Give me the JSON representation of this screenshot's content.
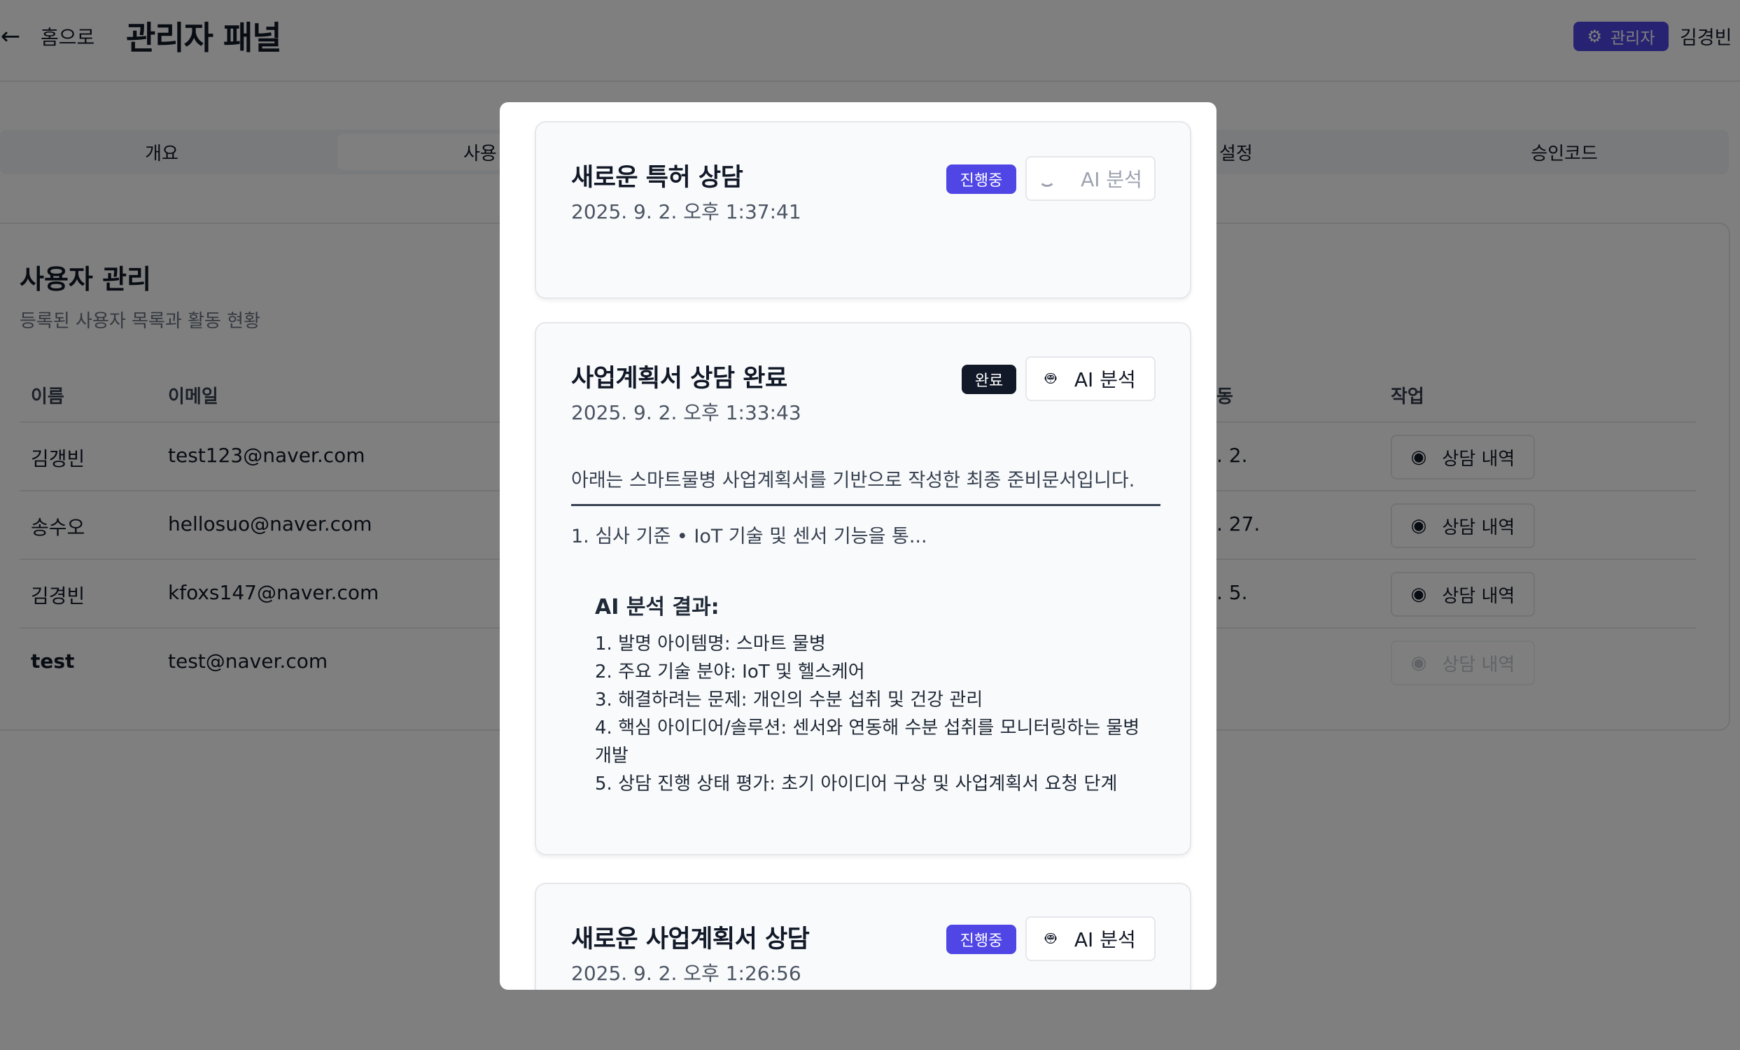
{
  "header": {
    "back_label": "홈으로",
    "title": "관리자 패널",
    "admin_badge": "관리자",
    "user_name": "김경빈"
  },
  "tabs": [
    "개요",
    "사용",
    "설정",
    "승인코드"
  ],
  "users_section": {
    "title": "사용자 관리",
    "subtitle": "등록된 사용자 목록과 활동 현황",
    "columns": [
      "이름",
      "이메일",
      "동",
      "작업"
    ],
    "rows": [
      {
        "name": "김갱빈",
        "email": "test123@naver.com",
        "date": ". 2.",
        "action": "상담 내역"
      },
      {
        "name": "송수오",
        "email": "hellosuo@naver.com",
        "date": ". 27.",
        "action": "상담 내역"
      },
      {
        "name": "김경빈",
        "email": "kfoxs147@naver.com",
        "date": ". 5.",
        "action": "상담 내역"
      },
      {
        "name": "test",
        "email": "test@naver.com",
        "date": "",
        "action": "상담 내역"
      }
    ]
  },
  "modal": {
    "consultations": [
      {
        "title": "새로운 특허 상담",
        "date": "2025. 9. 2. 오후 1:37:41",
        "status": "진행중",
        "ai_label": "AI 분석"
      },
      {
        "title": "사업계획서 상담 완료",
        "date": "2025. 9. 2. 오후 1:33:43",
        "status": "완료",
        "ai_label": "AI 분석",
        "summary": "아래는 스마트물병 사업계획서를 기반으로 작성한 최종 준비문서입니다.",
        "preview": "1. 심사 기준 • IoT 기술 및 센서 기능을 통...",
        "analysis_title": "AI 분석 결과:",
        "analysis_items": [
          "1. 발명 아이템명: 스마트 물병",
          "2. 주요 기술 분야: IoT 및 헬스케어",
          "3. 해결하려는 문제: 개인의 수분 섭취 및 건강 관리",
          "4. 핵심 아이디어/솔루션: 센서와 연동해 수분 섭취를 모니터링하는 물병 개발",
          "5. 상담 진행 상태 평가: 초기 아이디어 구상 및 사업계획서 요청 단계"
        ]
      },
      {
        "title": "새로운 사업계획서 상담",
        "date": "2025. 9. 2. 오후 1:26:56",
        "status": "진행중",
        "ai_label": "AI 분석"
      }
    ]
  },
  "icons": {
    "back": "arrow-left-icon",
    "admin": "gear-icon",
    "view": "eye-icon",
    "ai": "robot-icon",
    "loading": "spinner-icon"
  },
  "colors": {
    "accent": "#4f46e5",
    "done_badge": "#111827",
    "overlay": "rgba(0,0,0,0.5)"
  }
}
